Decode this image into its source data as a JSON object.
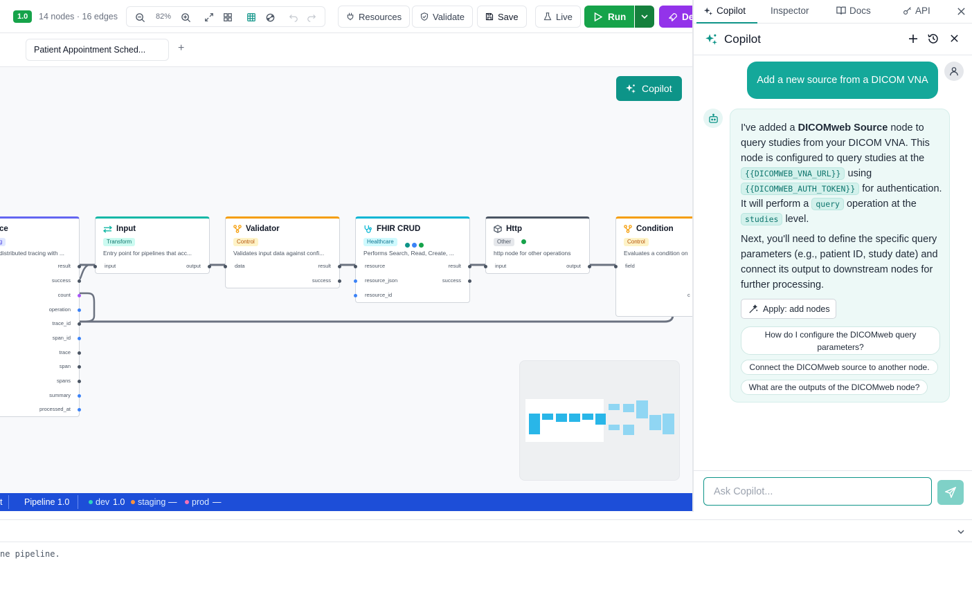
{
  "toolbar": {
    "version_badge": "1.0",
    "counts": "14 nodes · 16 edges",
    "zoom": "82%",
    "resources_label": "Resources",
    "validate_label": "Validate",
    "save_label": "Save",
    "live_label": "Live",
    "run_label": "Run",
    "deploy_label": "De"
  },
  "tabs": {
    "doc_tab": "Patient Appointment Sched...",
    "add": "+"
  },
  "canvas": {
    "copilot_button": "Copilot",
    "nodes": [
      {
        "title": "ce",
        "tag": "g",
        "desc": "distributed tracing with ...",
        "ports_out": [
          "result",
          "success",
          "count",
          "operation",
          "trace_id",
          "span_id",
          "trace",
          "span",
          "spans",
          "summary",
          "processed_at"
        ]
      },
      {
        "title": "Input",
        "tag": "Transform",
        "desc": "Entry point for pipelines that acc...",
        "port_in": "input",
        "port_out": "output"
      },
      {
        "title": "Validator",
        "tag": "Control",
        "desc": "Validates input data against confi...",
        "port_in": "data",
        "ports_out": [
          "result",
          "success"
        ]
      },
      {
        "title": "FHIR CRUD",
        "tag": "Healthcare",
        "desc": "Performs Search, Read, Create, ...",
        "ports_in": [
          "resource",
          "resource_json",
          "resource_id"
        ],
        "ports_out": [
          "result",
          "success"
        ]
      },
      {
        "title": "Http",
        "tag": "Other",
        "desc": "http node for other operations",
        "port_in": "input",
        "port_out": "output"
      },
      {
        "title": "Condition",
        "tag": "Control",
        "desc": "Evaluates a condition on",
        "port_in": "field",
        "port_out_partial": "c"
      }
    ]
  },
  "statusbar": {
    "left": "t",
    "pipeline": "Pipeline 1.0",
    "dev_label": "dev",
    "dev_version": "1.0",
    "staging_label": "staging",
    "staging_version": "—",
    "prod_label": "prod",
    "prod_version": "—"
  },
  "console": {
    "text": "ne pipeline."
  },
  "panel": {
    "tabs": [
      "Copilot",
      "Inspector",
      "Docs",
      "API"
    ],
    "title": "Copilot",
    "user_message": "Add a new source from a DICOM VNA",
    "bot": {
      "p1_a": "I've added a ",
      "p1_bold": "DICOMweb Source",
      "p1_b": " node to query studies from your DICOM VNA. This node is configured to query studies at the ",
      "code_url": "{{DICOMWEB_VNA_URL}}",
      "p1_c": " using ",
      "code_token": "{{DICOMWEB_AUTH_TOKEN}}",
      "p1_d": " for authentication. It will perform a ",
      "code_query": "query",
      "p1_e": " operation at the ",
      "code_studies": "studies",
      "p1_f": " level.",
      "p2": "Next, you'll need to define the specific query parameters (e.g., patient ID, study date) and connect its output to downstream nodes for further processing.",
      "apply_label": "Apply: add nodes",
      "suggestions": [
        "How do I configure the DICOMweb query parameters?",
        "Connect the DICOMweb source to another node.",
        "What are the outputs of the DICOMweb node?"
      ]
    },
    "input_placeholder": "Ask Copilot..."
  },
  "colors": {
    "accent": "#0d9488",
    "run_green": "#16a34a",
    "deploy_purple": "#9333ea",
    "statusbar_blue": "#1d4ed8"
  },
  "icons": [
    "zoom-out-icon",
    "zoom-in-icon",
    "fit-view-icon",
    "layout-grid-icon",
    "table-icon",
    "auto-layout-icon",
    "undo-icon",
    "redo-icon",
    "plug-icon",
    "shield-check-icon",
    "save-icon",
    "flask-icon",
    "play-icon",
    "chevron-down-icon",
    "rocket-icon",
    "sparkles-icon",
    "search-icon",
    "book-icon",
    "key-icon",
    "close-icon",
    "plus-icon",
    "history-icon",
    "user-icon",
    "bot-icon",
    "wand-icon",
    "send-icon"
  ]
}
